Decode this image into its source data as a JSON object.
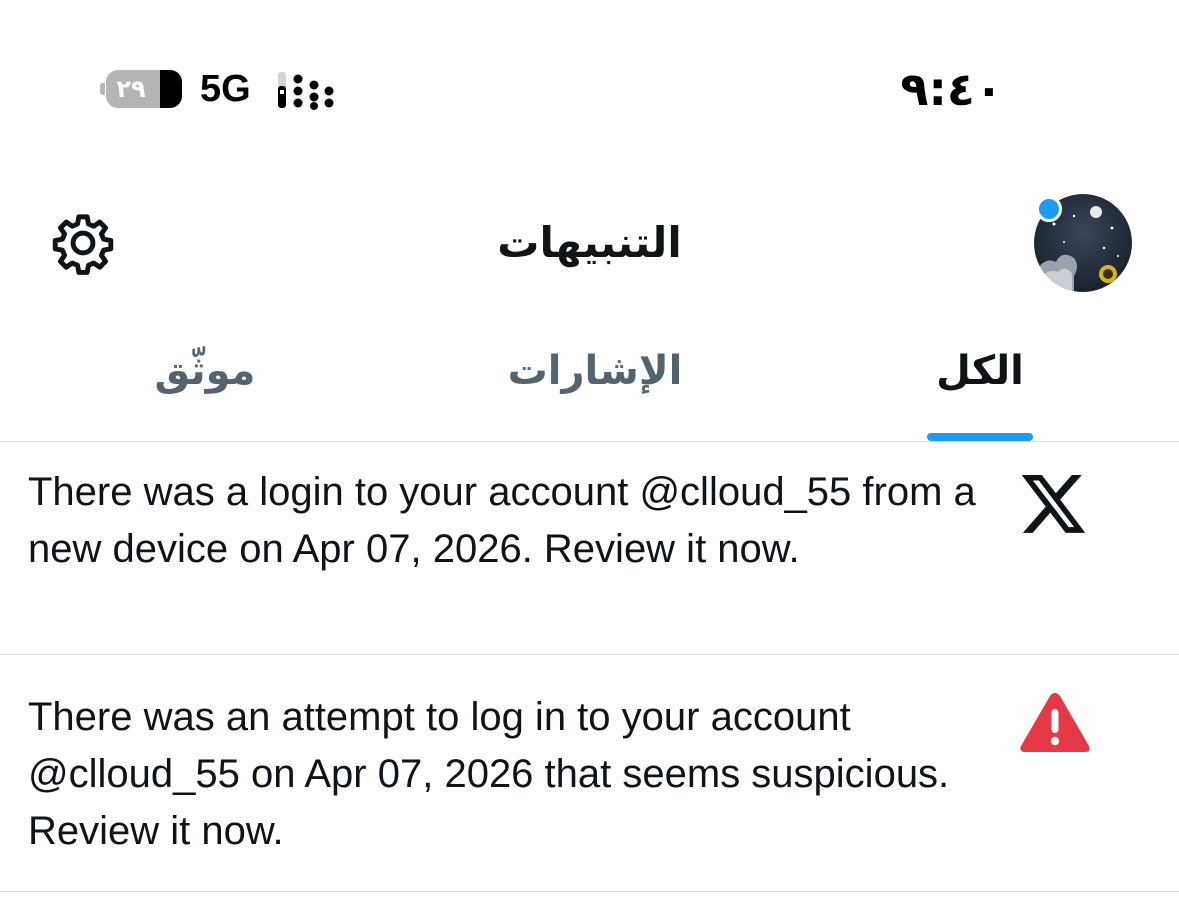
{
  "status_bar": {
    "time": "٩:٤٠",
    "battery_level": "٢٩",
    "battery_fraction": 0.29,
    "network": "5G"
  },
  "header": {
    "title": "التنبيهات",
    "settings_icon": "gear-icon",
    "avatar_has_new": true
  },
  "tabs": [
    {
      "label": "الكل",
      "active": true
    },
    {
      "label": "الإشارات",
      "active": false
    },
    {
      "label": "موثّق",
      "active": false
    }
  ],
  "notifications": [
    {
      "icon": "x-logo-icon",
      "text": "There was a login to your account @clloud_55 from a new device on Apr 07, 2026. Review it now."
    },
    {
      "icon": "warning-icon",
      "text": "There was an attempt to log in to your account @clloud_55 on Apr 07, 2026 that seems suspicious. Review it now."
    }
  ],
  "colors": {
    "accent": "#1d9bf0",
    "text_primary": "#0f1419",
    "text_secondary": "#536471",
    "warning": "#e0245e",
    "divider": "#dadde1"
  }
}
